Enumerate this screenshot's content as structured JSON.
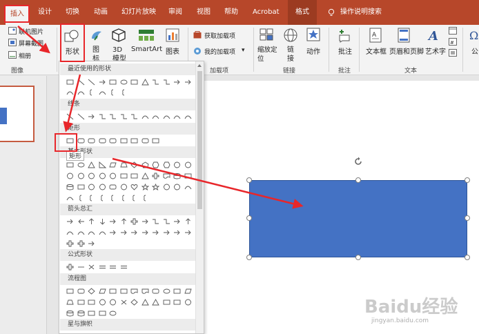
{
  "tabs": {
    "insert": "插入",
    "design": "设计",
    "transitions": "切换",
    "animations": "动画",
    "slideshow": "幻灯片放映",
    "review": "审阅",
    "view": "视图",
    "help": "帮助",
    "acrobat": "Acrobat",
    "format": "格式",
    "tell_me": "操作说明搜索"
  },
  "ribbon": {
    "images_group": {
      "online_pictures": "联机图片",
      "screenshot": "屏幕截图",
      "album": "相册",
      "label": "图像"
    },
    "shapes_label": "形状",
    "icons_label": "图标",
    "models_label": "3D 模型",
    "smartart_label": "SmartArt",
    "chart_label": "图表",
    "addins_group": {
      "get_addins": "获取加载项",
      "my_addins": "我的加载项",
      "label": "加载项"
    },
    "links_group": {
      "zoom": "缩放定位",
      "link": "链接",
      "action": "动作",
      "label": "链接"
    },
    "comments_group": {
      "comment": "批注",
      "label": "批注"
    },
    "text_group": {
      "textbox": "文本框",
      "header_footer": "页眉和页脚",
      "wordart": "艺术字",
      "label": "文本"
    },
    "truncated": "公"
  },
  "dropdown": {
    "sections": {
      "recent": "最近使用的形状",
      "lines": "线条",
      "rectangles": "矩形",
      "basic": "基本形状",
      "arrows": "箭头总汇",
      "equation": "公式形状",
      "flowchart": "流程图",
      "stars": "星与旗帜"
    },
    "tooltip": "矩形"
  },
  "colors": {
    "accent": "#b7472a",
    "shape_fill": "#4472c4",
    "annotation": "#e8262a"
  },
  "watermark": {
    "brand": "Baidu经验",
    "url": "jingyan.baidu.com"
  }
}
